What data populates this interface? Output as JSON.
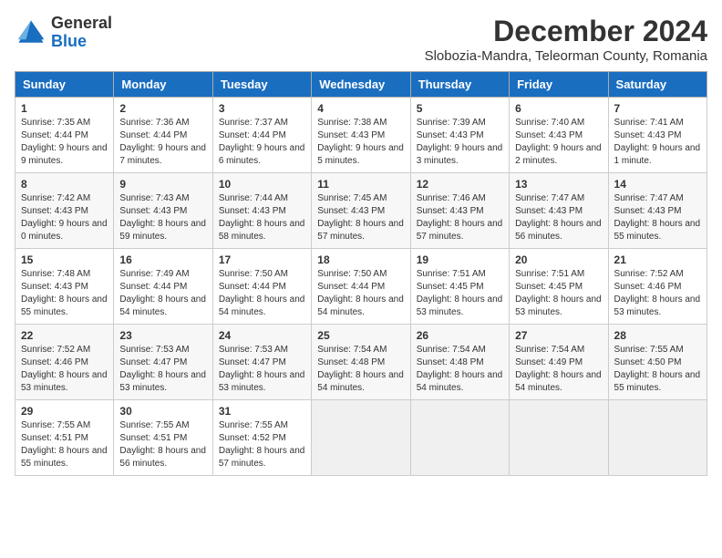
{
  "logo": {
    "general": "General",
    "blue": "Blue"
  },
  "title": "December 2024",
  "location": "Slobozia-Mandra, Teleorman County, Romania",
  "days_of_week": [
    "Sunday",
    "Monday",
    "Tuesday",
    "Wednesday",
    "Thursday",
    "Friday",
    "Saturday"
  ],
  "weeks": [
    [
      {
        "day": "1",
        "sunrise": "7:35 AM",
        "sunset": "4:44 PM",
        "daylight": "9 hours and 9 minutes."
      },
      {
        "day": "2",
        "sunrise": "7:36 AM",
        "sunset": "4:44 PM",
        "daylight": "9 hours and 7 minutes."
      },
      {
        "day": "3",
        "sunrise": "7:37 AM",
        "sunset": "4:44 PM",
        "daylight": "9 hours and 6 minutes."
      },
      {
        "day": "4",
        "sunrise": "7:38 AM",
        "sunset": "4:43 PM",
        "daylight": "9 hours and 5 minutes."
      },
      {
        "day": "5",
        "sunrise": "7:39 AM",
        "sunset": "4:43 PM",
        "daylight": "9 hours and 3 minutes."
      },
      {
        "day": "6",
        "sunrise": "7:40 AM",
        "sunset": "4:43 PM",
        "daylight": "9 hours and 2 minutes."
      },
      {
        "day": "7",
        "sunrise": "7:41 AM",
        "sunset": "4:43 PM",
        "daylight": "9 hours and 1 minute."
      }
    ],
    [
      {
        "day": "8",
        "sunrise": "7:42 AM",
        "sunset": "4:43 PM",
        "daylight": "9 hours and 0 minutes."
      },
      {
        "day": "9",
        "sunrise": "7:43 AM",
        "sunset": "4:43 PM",
        "daylight": "8 hours and 59 minutes."
      },
      {
        "day": "10",
        "sunrise": "7:44 AM",
        "sunset": "4:43 PM",
        "daylight": "8 hours and 58 minutes."
      },
      {
        "day": "11",
        "sunrise": "7:45 AM",
        "sunset": "4:43 PM",
        "daylight": "8 hours and 57 minutes."
      },
      {
        "day": "12",
        "sunrise": "7:46 AM",
        "sunset": "4:43 PM",
        "daylight": "8 hours and 57 minutes."
      },
      {
        "day": "13",
        "sunrise": "7:47 AM",
        "sunset": "4:43 PM",
        "daylight": "8 hours and 56 minutes."
      },
      {
        "day": "14",
        "sunrise": "7:47 AM",
        "sunset": "4:43 PM",
        "daylight": "8 hours and 55 minutes."
      }
    ],
    [
      {
        "day": "15",
        "sunrise": "7:48 AM",
        "sunset": "4:43 PM",
        "daylight": "8 hours and 55 minutes."
      },
      {
        "day": "16",
        "sunrise": "7:49 AM",
        "sunset": "4:44 PM",
        "daylight": "8 hours and 54 minutes."
      },
      {
        "day": "17",
        "sunrise": "7:50 AM",
        "sunset": "4:44 PM",
        "daylight": "8 hours and 54 minutes."
      },
      {
        "day": "18",
        "sunrise": "7:50 AM",
        "sunset": "4:44 PM",
        "daylight": "8 hours and 54 minutes."
      },
      {
        "day": "19",
        "sunrise": "7:51 AM",
        "sunset": "4:45 PM",
        "daylight": "8 hours and 53 minutes."
      },
      {
        "day": "20",
        "sunrise": "7:51 AM",
        "sunset": "4:45 PM",
        "daylight": "8 hours and 53 minutes."
      },
      {
        "day": "21",
        "sunrise": "7:52 AM",
        "sunset": "4:46 PM",
        "daylight": "8 hours and 53 minutes."
      }
    ],
    [
      {
        "day": "22",
        "sunrise": "7:52 AM",
        "sunset": "4:46 PM",
        "daylight": "8 hours and 53 minutes."
      },
      {
        "day": "23",
        "sunrise": "7:53 AM",
        "sunset": "4:47 PM",
        "daylight": "8 hours and 53 minutes."
      },
      {
        "day": "24",
        "sunrise": "7:53 AM",
        "sunset": "4:47 PM",
        "daylight": "8 hours and 53 minutes."
      },
      {
        "day": "25",
        "sunrise": "7:54 AM",
        "sunset": "4:48 PM",
        "daylight": "8 hours and 54 minutes."
      },
      {
        "day": "26",
        "sunrise": "7:54 AM",
        "sunset": "4:48 PM",
        "daylight": "8 hours and 54 minutes."
      },
      {
        "day": "27",
        "sunrise": "7:54 AM",
        "sunset": "4:49 PM",
        "daylight": "8 hours and 54 minutes."
      },
      {
        "day": "28",
        "sunrise": "7:55 AM",
        "sunset": "4:50 PM",
        "daylight": "8 hours and 55 minutes."
      }
    ],
    [
      {
        "day": "29",
        "sunrise": "7:55 AM",
        "sunset": "4:51 PM",
        "daylight": "8 hours and 55 minutes."
      },
      {
        "day": "30",
        "sunrise": "7:55 AM",
        "sunset": "4:51 PM",
        "daylight": "8 hours and 56 minutes."
      },
      {
        "day": "31",
        "sunrise": "7:55 AM",
        "sunset": "4:52 PM",
        "daylight": "8 hours and 57 minutes."
      },
      null,
      null,
      null,
      null
    ]
  ]
}
